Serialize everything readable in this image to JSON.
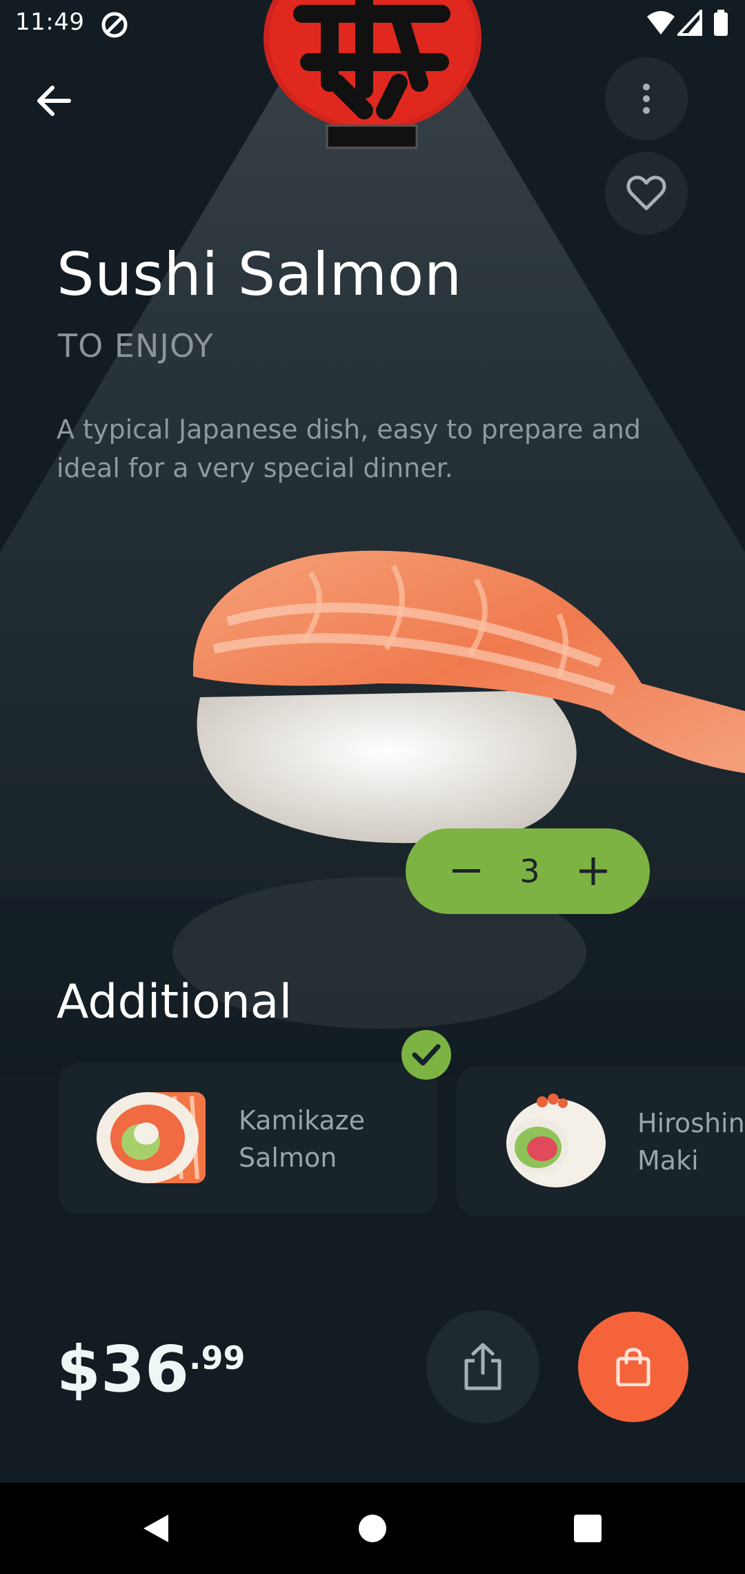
{
  "status_bar": {
    "time": "11:49",
    "icons": [
      "at-sign-icon",
      "wifi-icon",
      "signal-icon",
      "battery-icon"
    ]
  },
  "header": {
    "back_icon": "arrow-left-icon",
    "more_icon": "more-vertical-icon",
    "favorite_icon": "heart-outline-icon"
  },
  "product": {
    "title": "Sushi Salmon",
    "subtitle": "TO ENJOY",
    "description": "A typical Japanese dish, easy to prepare and ideal for a very special dinner."
  },
  "quantity": {
    "value": "3",
    "decrement_icon": "minus-icon",
    "increment_icon": "plus-icon"
  },
  "additional": {
    "title": "Additional",
    "items": [
      {
        "name": "Kamikaze\nSalmon",
        "selected": true
      },
      {
        "name": "Hiroshin\nMaki",
        "selected": false
      }
    ]
  },
  "footer": {
    "price_main": "$36",
    "price_cents": ".99",
    "share_icon": "share-icon",
    "cart_icon": "shopping-bag-icon"
  },
  "colors": {
    "background": "#121c22",
    "accent_green": "#7cb342",
    "accent_orange": "#f4633a"
  },
  "nav_bar": {
    "icons": [
      "back-triangle-icon",
      "home-circle-icon",
      "recents-square-icon"
    ]
  }
}
